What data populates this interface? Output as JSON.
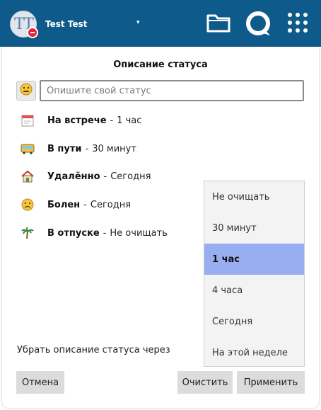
{
  "header": {
    "avatar_initials": "TT",
    "username": "Test Test",
    "caret": "▾",
    "icons": [
      "folder-icon",
      "talk-icon",
      "apps-grid-icon"
    ],
    "status_color": "#e2233a"
  },
  "dialog": {
    "title": "Описание статуса",
    "input": {
      "placeholder": "Опишите свой статус",
      "value": ""
    },
    "emoji_button_icon": "smiley-icon",
    "presets": [
      {
        "icon": "calendar-icon",
        "label": "На встрече",
        "sep": "-",
        "duration": "1 час"
      },
      {
        "icon": "bus-icon",
        "label": "В пути",
        "sep": "-",
        "duration": "30 минут"
      },
      {
        "icon": "house-icon",
        "label": "Удалённо",
        "sep": "-",
        "duration": "Сегодня"
      },
      {
        "icon": "sick-face-icon",
        "label": "Болен",
        "sep": "-",
        "duration": "Сегодня"
      },
      {
        "icon": "palm-tree-icon",
        "label": "В отпуске",
        "sep": "-",
        "duration": "Не очищать"
      }
    ],
    "clear_after_label": "Убрать описание статуса через",
    "clear_after_options": [
      "Не очищать",
      "30 минут",
      "1 час",
      "4 часа",
      "Сегодня",
      "На этой неделе"
    ],
    "clear_after_selected": "1 час",
    "buttons": {
      "cancel": "Отмена",
      "clear": "Очистить",
      "apply": "Применить"
    }
  },
  "colors": {
    "header_bg": "#0e5a8a",
    "selected_option": "#99aef0",
    "button_bg": "#dcdcdc"
  }
}
